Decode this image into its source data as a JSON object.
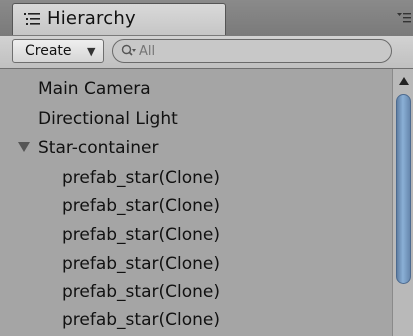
{
  "tab": {
    "title": "Hierarchy",
    "icon": "hierarchy-list-icon",
    "menu_icon": "panel-menu-icon"
  },
  "toolbar": {
    "create_label": "Create",
    "create_dropdown_icon": "dropdown-arrow-icon",
    "search_placeholder": "All",
    "search_icon": "search-filter-icon"
  },
  "hierarchy": {
    "items": [
      {
        "label": "Main Camera",
        "depth": 0
      },
      {
        "label": "Directional Light",
        "depth": 0
      },
      {
        "label": "Star-container",
        "depth": 0,
        "expanded": true
      },
      {
        "label": "prefab_star(Clone)",
        "depth": 1
      },
      {
        "label": "prefab_star(Clone)",
        "depth": 1
      },
      {
        "label": "prefab_star(Clone)",
        "depth": 1
      },
      {
        "label": "prefab_star(Clone)",
        "depth": 1
      },
      {
        "label": "prefab_star(Clone)",
        "depth": 1
      },
      {
        "label": "prefab_star(Clone)",
        "depth": 1
      }
    ]
  },
  "colors": {
    "panel_bg": "#a5a5a5",
    "scroll_thumb": "#7f9fc4"
  }
}
